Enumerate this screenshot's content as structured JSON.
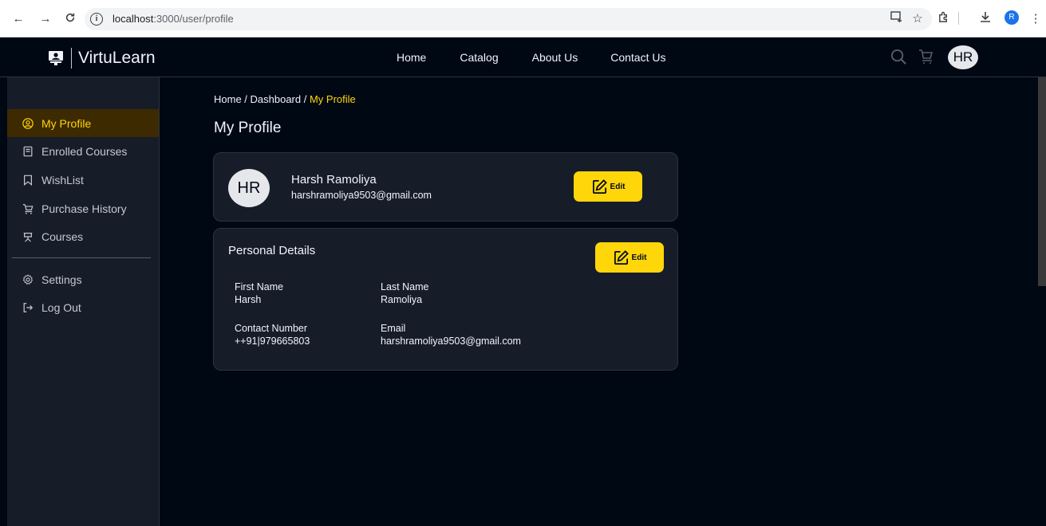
{
  "browser": {
    "url_host": "localhost",
    "url_path": ":3000/user/profile",
    "profile_initial": "R"
  },
  "navbar": {
    "brand": "VirtuLearn",
    "links": [
      "Home",
      "Catalog",
      "About Us",
      "Contact Us"
    ],
    "avatar_initials": "HR"
  },
  "sidebar": {
    "items": [
      {
        "label": "My Profile",
        "icon": "user-circle-icon",
        "active": true
      },
      {
        "label": "Enrolled Courses",
        "icon": "notebook-icon"
      },
      {
        "label": "WishList",
        "icon": "bookmark-icon"
      },
      {
        "label": "Purchase History",
        "icon": "cart-icon"
      },
      {
        "label": "Courses",
        "icon": "courses-icon"
      }
    ],
    "bottom_items": [
      {
        "label": "Settings",
        "icon": "gear-icon"
      },
      {
        "label": "Log Out",
        "icon": "logout-icon"
      }
    ]
  },
  "breadcrumb": {
    "path": "Home / Dashboard / ",
    "current": "My Profile"
  },
  "page": {
    "title": "My Profile"
  },
  "profile_card": {
    "avatar_initials": "HR",
    "name": "Harsh Ramoliya",
    "email": "harshramoliya9503@gmail.com",
    "edit_label": "Edit"
  },
  "personal_details": {
    "title": "Personal Details",
    "edit_label": "Edit",
    "first_name_label": "First Name",
    "first_name": "Harsh",
    "last_name_label": "Last Name",
    "last_name": "Ramoliya",
    "contact_label": "Contact Number",
    "contact": "++91|979665803",
    "email_label": "Email",
    "email": "harshramoliya9503@gmail.com"
  },
  "colors": {
    "accent": "#ffd60a",
    "background": "#000814",
    "sidebar": "#161d29",
    "card": "#161d29"
  }
}
